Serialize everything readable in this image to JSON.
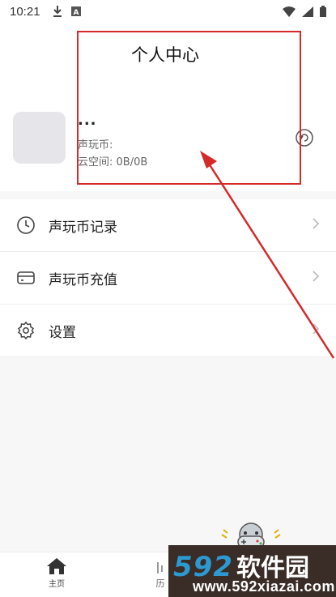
{
  "status_bar": {
    "time": "10:21",
    "icons_left": [
      "download-icon",
      "a-badge-icon"
    ],
    "icons_right": [
      "wifi-icon",
      "signal-icon",
      "battery-icon"
    ]
  },
  "header": {
    "title": "个人中心",
    "user_name": "...",
    "coin_label": "声玩币:",
    "cloud_label": "云空间: 0B/0B"
  },
  "menu": {
    "items": [
      {
        "label": "声玩币记录",
        "icon": "clock-icon"
      },
      {
        "label": "声玩币充值",
        "icon": "card-icon"
      },
      {
        "label": "设置",
        "icon": "gear-icon"
      }
    ]
  },
  "bottom_nav": {
    "home_label": "主页",
    "history_label": "历"
  },
  "watermark": {
    "number": "592",
    "cn_text": "软件园",
    "url": "www.592xiazai.com"
  },
  "colors": {
    "annotation_red": "#d42a2a",
    "watermark_blue": "#2c9ad1",
    "watermark_bg": "#3a2c26"
  }
}
